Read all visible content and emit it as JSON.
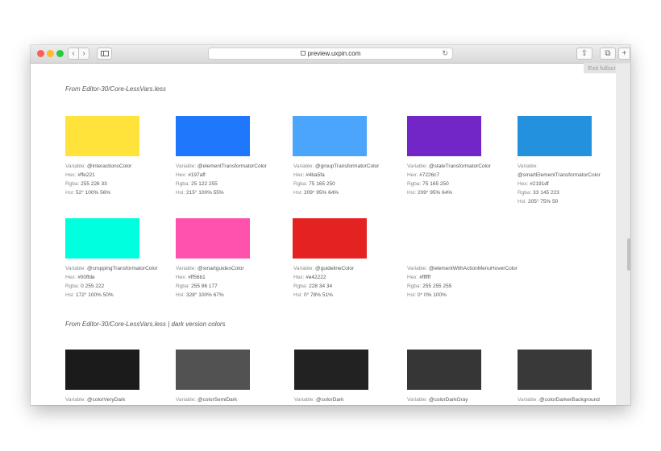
{
  "browser": {
    "url": "preview.uxpin.com",
    "back_glyph": "‹",
    "forward_glyph": "›",
    "reload_glyph": "↻",
    "share_glyph": "⇪",
    "tabs_glyph": "⧉",
    "plus_glyph": "+",
    "exit_fullscreen_label": "Exit fullscreen"
  },
  "labels": {
    "variable": "Variable:",
    "hex": "Hex:",
    "rgba": "Rgba:",
    "hsl": "Hsl:"
  },
  "sections": [
    {
      "title": "From Editor-30/Core-LessVars.less"
    },
    {
      "title": "From Editor-30/Core-LessVars.less | dark version colors"
    }
  ],
  "colors": [
    {
      "variable": "@interactionsColor",
      "hex": "#ffe221",
      "rgba": "255 226 33",
      "hsl": "52° 100% 56%",
      "swatch": "#ffe23a"
    },
    {
      "variable": "@elementTransformatorColor",
      "hex": "#197aff",
      "rgba": "25 122 255",
      "hsl": "215° 100% 55%",
      "swatch": "#1f78fb"
    },
    {
      "variable": "@groupTransformatorColor",
      "hex": "#4ba5fa",
      "rgba": "75 165 250",
      "hsl": "209° 95% 64%",
      "swatch": "#4ba5fa"
    },
    {
      "variable": "@stateTransformatorColor",
      "hex": "#7226c7",
      "rgba": "75 165 250",
      "hsl": "209° 95% 64%",
      "swatch": "#7226c7"
    },
    {
      "variable_line1": "",
      "variable_line2": "@smartElementTransformatorColor",
      "hex": "#2191df",
      "rgba": "33 145 223",
      "hsl": "205° 75% 50",
      "swatch": "#2491df"
    },
    {
      "variable": "@croppingTransformatorColor",
      "hex": "#00ffde",
      "rgba": "0 255 222",
      "hsl": "172° 100% 50%",
      "swatch": "#00ffde"
    },
    {
      "variable": "@smartguidesColor",
      "hex": "#ff56b1",
      "rgba": "255 86 177",
      "hsl": "328° 100% 67%",
      "swatch": "#ff52af"
    },
    {
      "variable": "@guidelineColor",
      "hex": "#e42222",
      "rgba": "228 34 34",
      "hsl": "0° 78% 51%",
      "swatch": "#e42222"
    },
    {
      "variable": "@elementWithActionMenuHoverColor",
      "hex": "#ffffff",
      "rgba": "255 255 255",
      "hsl": "0° 0% 100%",
      "swatch": "#ffffff"
    }
  ],
  "dark_colors": [
    {
      "variable": "@colorVeryDark",
      "swatch": "#1b1b1b"
    },
    {
      "variable": "@colorSemiDark",
      "swatch": "#525252"
    },
    {
      "variable": "@colorDark",
      "swatch": "#222222"
    },
    {
      "variable": "@colorDarkGray",
      "swatch": "#363636"
    },
    {
      "variable": "@colorDarkerBackground",
      "swatch": "#393939"
    }
  ]
}
